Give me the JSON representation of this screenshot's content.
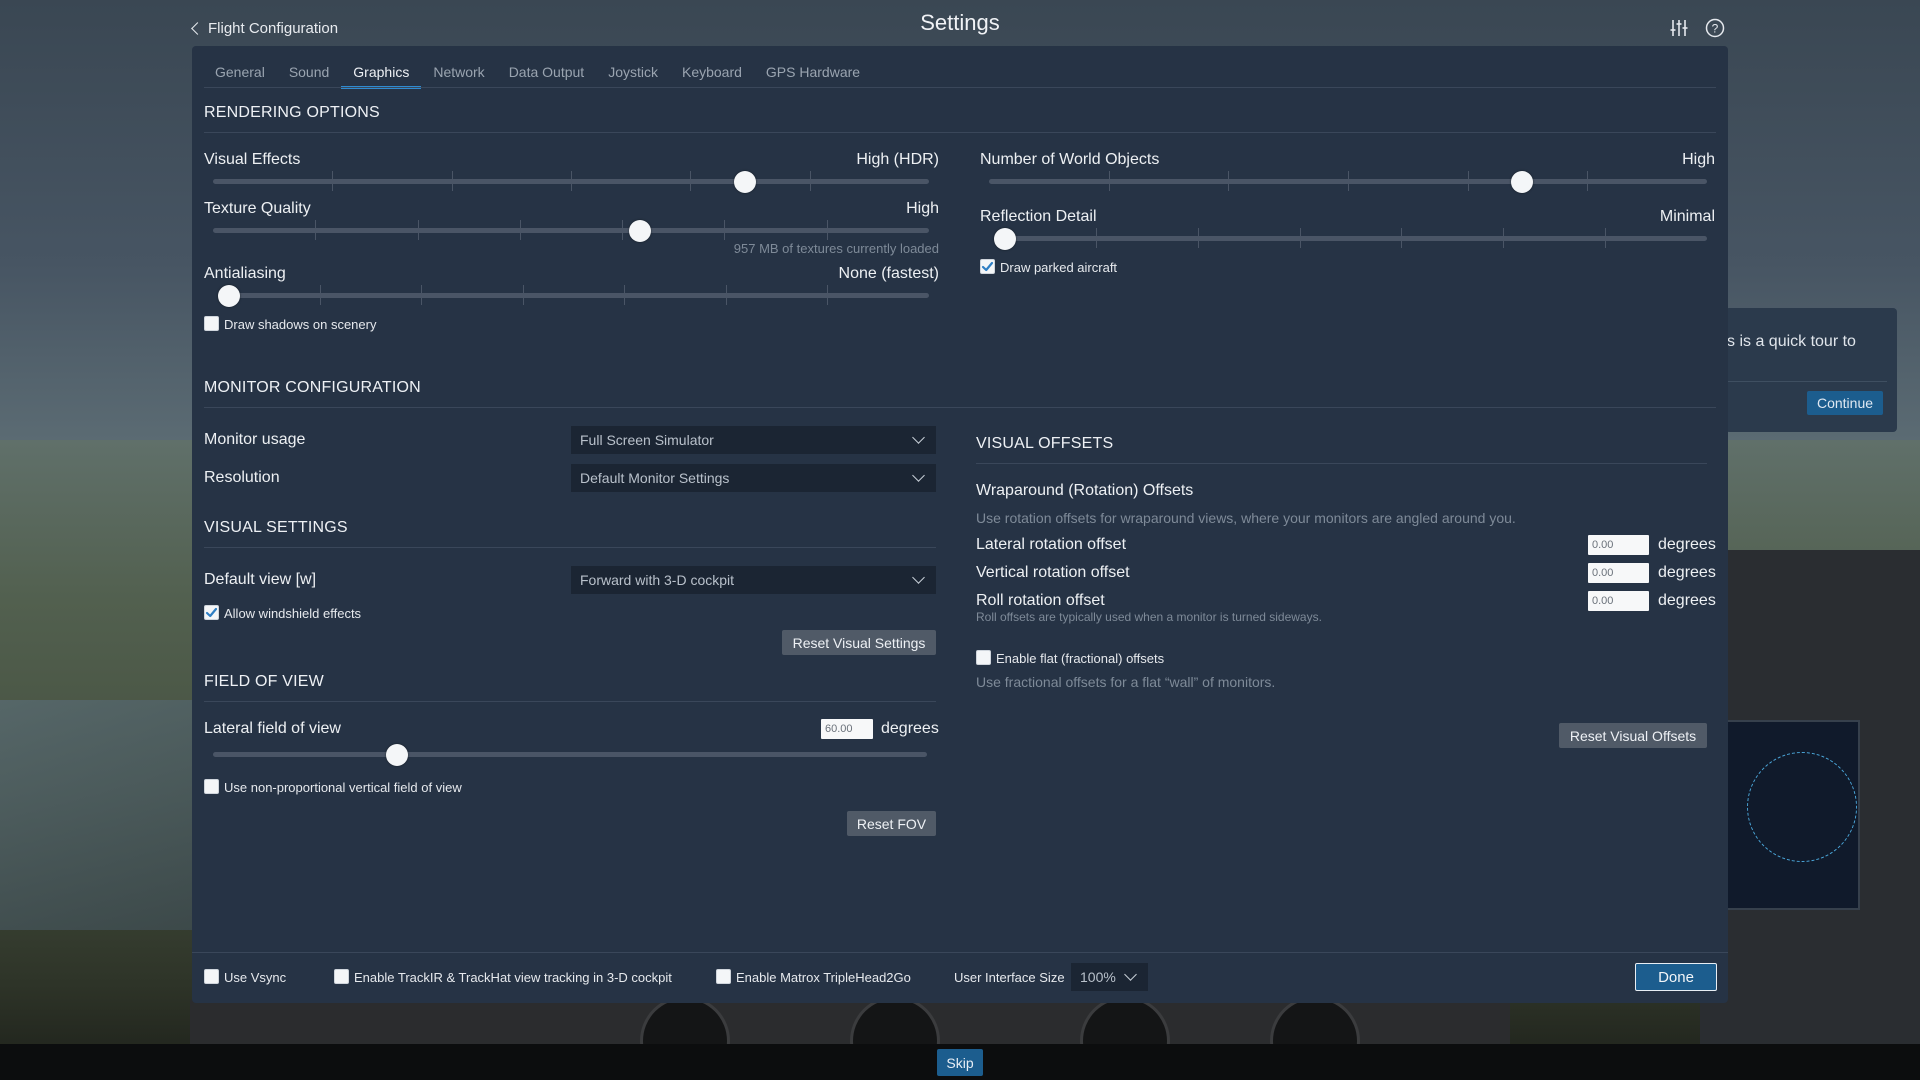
{
  "header": {
    "back_label": "Flight Configuration",
    "title": "Settings",
    "icons": [
      "sliders-icon",
      "help-icon"
    ]
  },
  "tabs": [
    {
      "label": "General",
      "active": false
    },
    {
      "label": "Sound",
      "active": false
    },
    {
      "label": "Graphics",
      "active": true
    },
    {
      "label": "Network",
      "active": false
    },
    {
      "label": "Data Output",
      "active": false
    },
    {
      "label": "Joystick",
      "active": false
    },
    {
      "label": "Keyboard",
      "active": false
    },
    {
      "label": "GPS Hardware",
      "active": false
    }
  ],
  "rendering": {
    "heading": "RENDERING OPTIONS",
    "visual_effects": {
      "label": "Visual Effects",
      "value_label": "High (HDR)",
      "level": 0.75
    },
    "texture_quality": {
      "label": "Texture Quality",
      "value_label": "High",
      "level": 0.6,
      "note": "957 MB of textures currently loaded"
    },
    "antialiasing": {
      "label": "Antialiasing",
      "value_label": "None (fastest)",
      "level": 0.0
    },
    "draw_shadows": {
      "label": "Draw shadows on scenery",
      "checked": false
    },
    "world_objects": {
      "label": "Number of World Objects",
      "value_label": "High",
      "level": 0.75
    },
    "reflection_detail": {
      "label": "Reflection Detail",
      "value_label": "Minimal",
      "level": 0.0
    },
    "draw_parked": {
      "label": "Draw parked aircraft",
      "checked": true
    }
  },
  "monitor": {
    "heading": "MONITOR CONFIGURATION",
    "usage": {
      "label": "Monitor usage",
      "value": "Full Screen Simulator"
    },
    "resolution": {
      "label": "Resolution",
      "value": "Default Monitor Settings"
    }
  },
  "visual_settings": {
    "heading": "VISUAL SETTINGS",
    "default_view": {
      "label": "Default view [w]",
      "value": "Forward with 3-D cockpit"
    },
    "windshield": {
      "label": "Allow windshield effects",
      "checked": true
    },
    "reset_label": "Reset Visual Settings"
  },
  "fov": {
    "heading": "FIELD OF VIEW",
    "lateral": {
      "label": "Lateral field of view",
      "value": "60.00",
      "unit": "degrees",
      "level": 0.25
    },
    "non_proportional": {
      "label": "Use non-proportional vertical field of view",
      "checked": false
    },
    "reset_label": "Reset FOV"
  },
  "visual_offsets": {
    "heading": "VISUAL OFFSETS",
    "wraparound_title": "Wraparound (Rotation) Offsets",
    "wraparound_desc": "Use rotation offsets for wraparound views, where your monitors are angled around you.",
    "lateral": {
      "label": "Lateral rotation offset",
      "value": "0.00",
      "unit": "degrees"
    },
    "vertical": {
      "label": "Vertical rotation offset",
      "value": "0.00",
      "unit": "degrees"
    },
    "roll": {
      "label": "Roll rotation offset",
      "value": "0.00",
      "unit": "degrees",
      "note": "Roll offsets are typically used when a monitor is turned sideways."
    },
    "flat": {
      "label": "Enable flat (fractional) offsets",
      "checked": false,
      "desc": "Use fractional offsets for a flat “wall” of monitors."
    },
    "reset_label": "Reset Visual Offsets"
  },
  "footer": {
    "vsync": {
      "label": "Use Vsync",
      "checked": false
    },
    "trackir": {
      "label": "Enable TrackIR & TrackHat view tracking in 3-D cockpit",
      "checked": false
    },
    "matrox": {
      "label": "Enable Matrox TripleHead2Go",
      "checked": false
    },
    "ui_size_label": "User Interface Size",
    "ui_size_value": "100%",
    "done_label": "Done"
  },
  "tour": {
    "text": "s is a quick tour to",
    "continue_label": "Continue",
    "skip_label": "Skip"
  },
  "colors": {
    "panel_bg": "#263345",
    "accent": "#2f8bd0",
    "button_blue": "#1c5d8e"
  }
}
